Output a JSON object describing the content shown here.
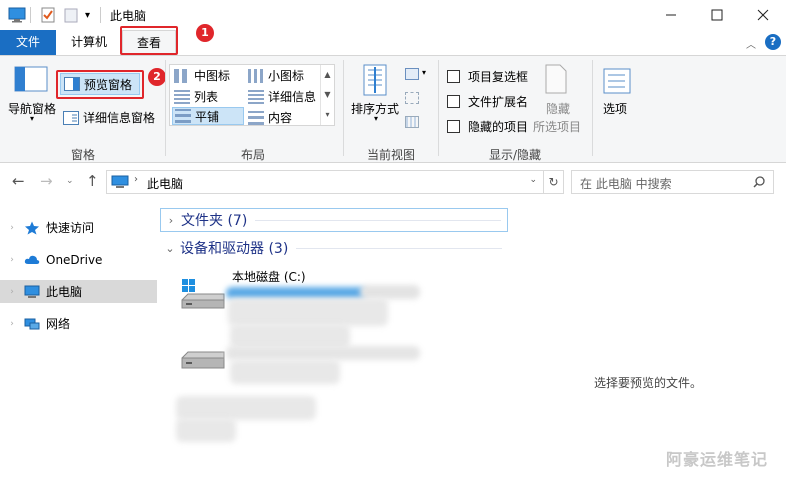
{
  "window": {
    "title": "此电脑"
  },
  "tabs": {
    "file": "文件",
    "computer": "计算机",
    "view": "查看"
  },
  "badges": {
    "one": "1",
    "two": "2"
  },
  "ribbon": {
    "panes": {
      "nav_pane": "导航窗格",
      "preview_pane": "预览窗格",
      "details_pane": "详细信息窗格",
      "label": "窗格"
    },
    "layout": {
      "items": [
        "中图标",
        "小图标",
        "列表",
        "详细信息",
        "平铺",
        "内容"
      ],
      "selected": "平铺",
      "label": "布局"
    },
    "current_view": {
      "sort_by": "排序方式",
      "label": "当前视图"
    },
    "show_hide": {
      "item_checkboxes": "项目复选框",
      "file_extensions": "文件扩展名",
      "hidden_items": "隐藏的项目",
      "hide_selected_line1": "隐藏",
      "hide_selected_line2": "所选项目",
      "label": "显示/隐藏"
    },
    "options": {
      "label": "选项"
    }
  },
  "address": {
    "path": "此电脑",
    "search_placeholder": "在 此电脑 中搜索"
  },
  "nav": {
    "items": [
      {
        "label": "快速访问"
      },
      {
        "label": "OneDrive"
      },
      {
        "label": "此电脑"
      },
      {
        "label": "网络"
      }
    ]
  },
  "content": {
    "folders_group": "文件夹 (7)",
    "devices_group": "设备和驱动器 (3)",
    "drive1_name": "本地磁盘 (C:)"
  },
  "preview": {
    "empty_text": "选择要预览的文件。"
  },
  "watermark": "阿豪运维笔记",
  "colors": {
    "accent": "#1a6ec3",
    "annotation_red": "#e0262b",
    "selection": "#cce4f7"
  }
}
